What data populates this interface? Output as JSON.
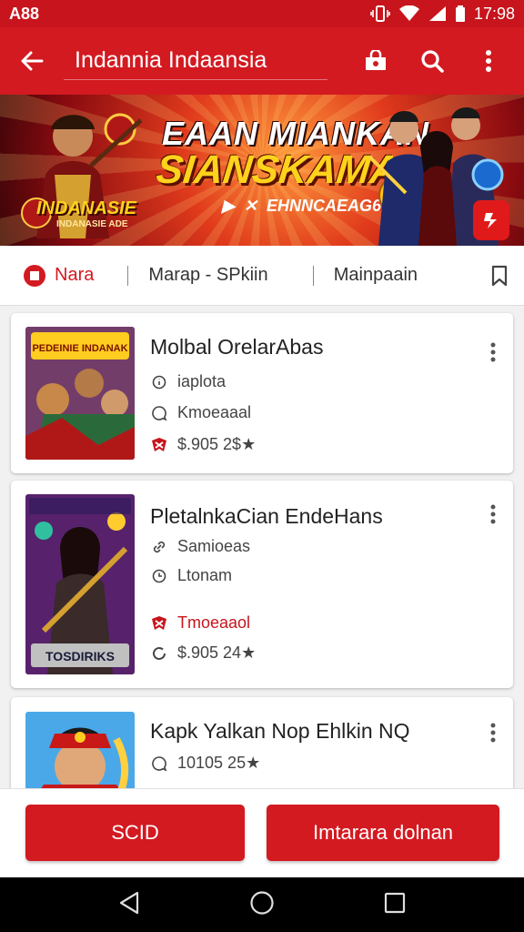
{
  "status_bar": {
    "time_left": "A88",
    "time_right": "17:98"
  },
  "app_bar": {
    "title": "Indannia Indaansia"
  },
  "banner": {
    "headline_1": "EAAN MIANKAN",
    "headline_2": "SIANSKAMAN!",
    "subline": "EHNNCAEAG61",
    "left_tag": "INDANASIE",
    "left_tag_sub": "INDANASIE ADE"
  },
  "tabs": [
    {
      "label": "Nara"
    },
    {
      "label": "Marap - SPkiin"
    },
    {
      "label": "Mainpaain"
    }
  ],
  "apps": [
    {
      "name": "Molbal OrelarAbas",
      "thumb_text": "PEDEINIE INDANAK",
      "rows": [
        {
          "icon": "info-icon",
          "text": "iaplota",
          "red": false
        },
        {
          "icon": "chat-icon",
          "text": "Kmoeaaal",
          "red": false
        },
        {
          "icon": "tag-icon",
          "text": "$.905 2$★",
          "red": false
        }
      ]
    },
    {
      "name": "PletalnkaCian EndeHans",
      "thumb_text": "TOSDIRIKS",
      "rows": [
        {
          "icon": "link-icon",
          "text": "Samioeas",
          "red": false
        },
        {
          "icon": "clock-icon",
          "text": "Ltonam",
          "red": false
        },
        {
          "icon": "tag-icon",
          "text": "Tmoeaaol",
          "red": true
        },
        {
          "icon": "loading-icon",
          "text": "$.905 24★",
          "red": false
        }
      ]
    },
    {
      "name": "Kapk Yalkan Nop Ehlkin NQ",
      "thumb_text": "",
      "rows": [
        {
          "icon": "chat-icon",
          "text": "10105 25★",
          "red": false
        }
      ]
    }
  ],
  "actions": {
    "primary": "SCID",
    "secondary": "Imtarara dolnan"
  },
  "colors": {
    "brand_red": "#d31a21",
    "status_red": "#c8141c",
    "text_dark": "#222222"
  }
}
